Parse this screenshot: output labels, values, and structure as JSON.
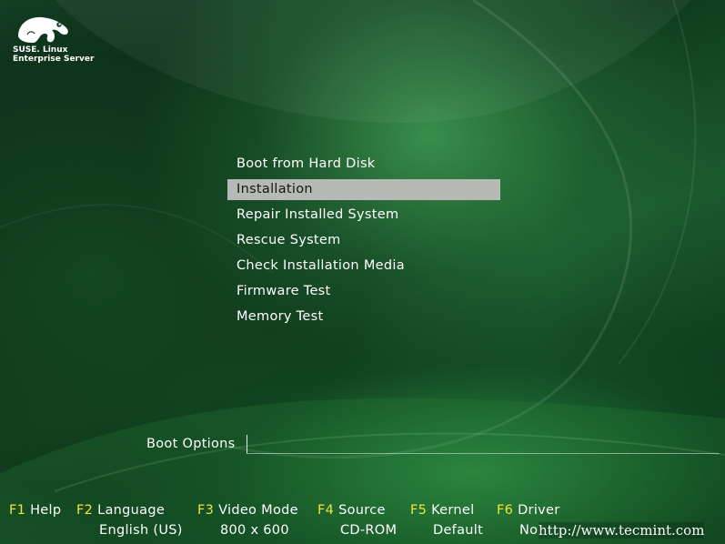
{
  "logo": {
    "line1": "SUSE. Linux",
    "line2": "Enterprise Server"
  },
  "menu": {
    "items": [
      {
        "label": "Boot from Hard Disk",
        "selected": false
      },
      {
        "label": "Installation",
        "selected": true
      },
      {
        "label": "Repair Installed System",
        "selected": false
      },
      {
        "label": "Rescue System",
        "selected": false
      },
      {
        "label": "Check Installation Media",
        "selected": false
      },
      {
        "label": "Firmware Test",
        "selected": false
      },
      {
        "label": "Memory Test",
        "selected": false
      }
    ]
  },
  "boot_options": {
    "label": "Boot Options",
    "value": ""
  },
  "fkeys": [
    {
      "key": "F1",
      "label": "Help",
      "value": ""
    },
    {
      "key": "F2",
      "label": "Language",
      "value": "English (US)"
    },
    {
      "key": "F3",
      "label": "Video Mode",
      "value": "800 x 600"
    },
    {
      "key": "F4",
      "label": "Source",
      "value": "CD-ROM"
    },
    {
      "key": "F5",
      "label": "Kernel",
      "value": "Default"
    },
    {
      "key": "F6",
      "label": "Driver",
      "value": "No"
    }
  ],
  "watermark": "http://www.tecmint.com",
  "colors": {
    "fkey_accent": "#f2e23a",
    "selection_bg": "#b7b9b7",
    "background": "#174a2a"
  }
}
